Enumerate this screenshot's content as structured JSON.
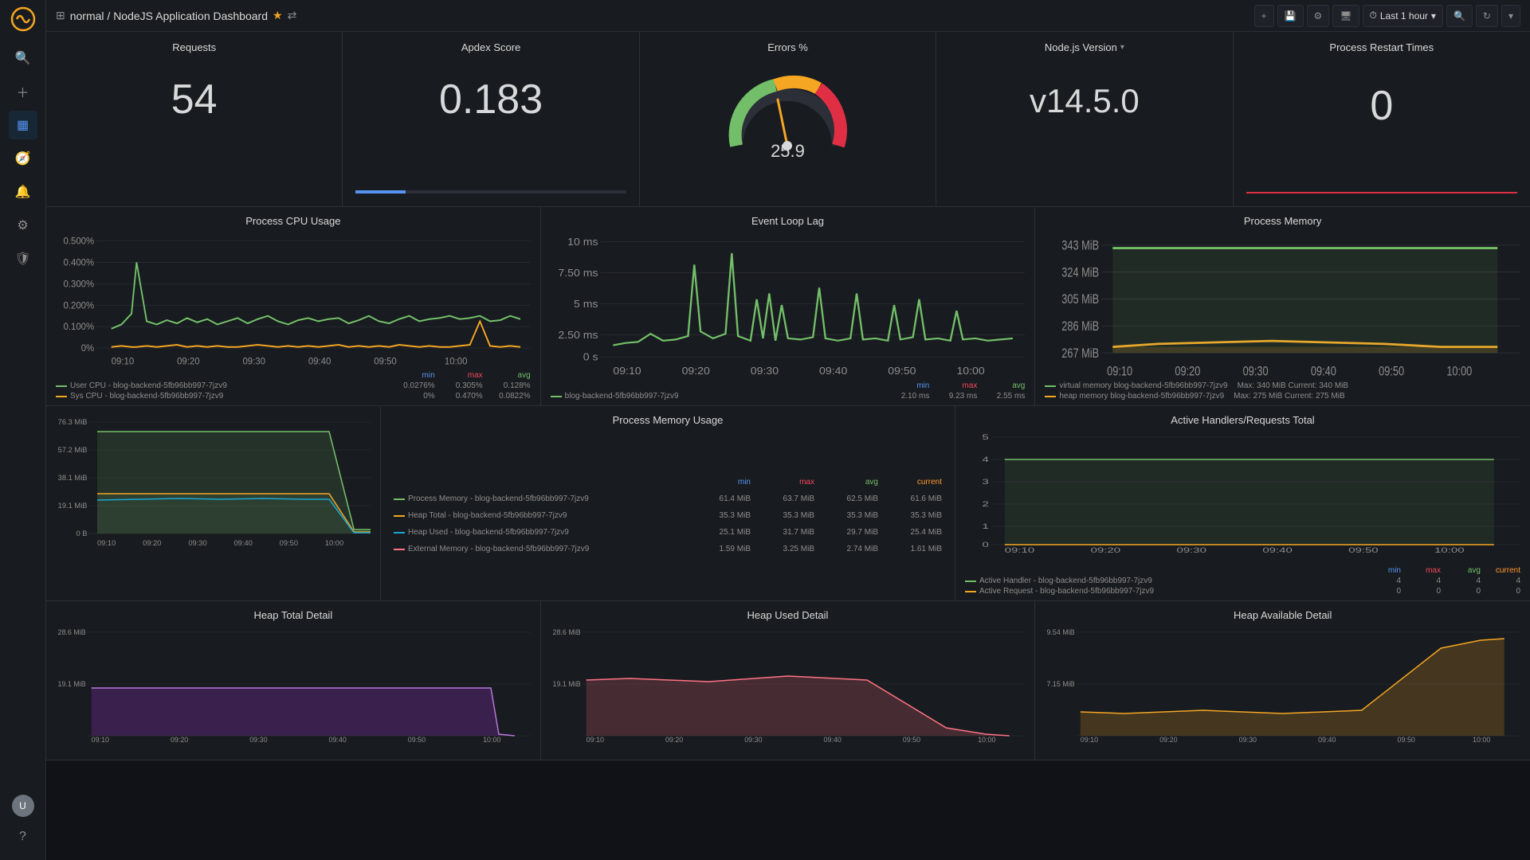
{
  "app": {
    "title": "normal / NodeJS Application Dashboard",
    "breadcrumb": "normal / NodeJS Application Dashboard"
  },
  "topbar": {
    "grid_icon": "⊞",
    "title": "normal / NodeJS Application Dashboard",
    "star_label": "★",
    "share_label": "⇄",
    "add_panel": "+",
    "save_label": "💾",
    "settings_label": "⚙",
    "monitor_label": "🖥",
    "time_range": "Last 1 hour",
    "zoom_out": "🔍",
    "refresh": "↻",
    "dropdown": "▾"
  },
  "stats": {
    "requests": {
      "title": "Requests",
      "value": "54"
    },
    "apdex": {
      "title": "Apdex Score",
      "value": "0.183"
    },
    "errors": {
      "title": "Errors %",
      "value": "25.9"
    },
    "nodejs": {
      "title": "Node.js Version",
      "value": "v14.5.0"
    },
    "restarts": {
      "title": "Process Restart Times",
      "value": "0"
    }
  },
  "cpu_chart": {
    "title": "Process CPU Usage",
    "y_labels": [
      "0.500%",
      "0.400%",
      "0.300%",
      "0.200%",
      "0.100%",
      "0%"
    ],
    "x_labels": [
      "09:10",
      "09:20",
      "09:30",
      "09:40",
      "09:50",
      "10:00"
    ],
    "legend_headers": [
      "",
      "min",
      "max",
      "avg"
    ],
    "legend": [
      {
        "color": "#73bf69",
        "label": "User CPU - blog-backend-5fb96bb997-7jzv9",
        "min": "0.0276%",
        "max": "0.305%",
        "avg": "0.128%"
      },
      {
        "color": "#f5a623",
        "label": "Sys CPU - blog-backend-5fb96bb997-7jzv9",
        "min": "0%",
        "max": "0.470%",
        "avg": "0.0822%"
      }
    ]
  },
  "event_chart": {
    "title": "Event Loop Lag",
    "y_labels": [
      "10 ms",
      "7.50 ms",
      "5 ms",
      "2.50 ms",
      "0 s"
    ],
    "x_labels": [
      "09:10",
      "09:20",
      "09:30",
      "09:40",
      "09:50",
      "10:00"
    ],
    "legend_headers": [
      "",
      "min",
      "max",
      "avg"
    ],
    "legend": [
      {
        "color": "#73bf69",
        "label": "blog-backend-5fb96bb997-7jzv9",
        "min": "2.10 ms",
        "max": "9.23 ms",
        "avg": "2.55 ms"
      }
    ]
  },
  "memory_chart": {
    "title": "Process Memory",
    "y_labels": [
      "343 MiB",
      "324 MiB",
      "305 MiB",
      "286 MiB",
      "267 MiB"
    ],
    "x_labels": [
      "09:10",
      "09:20",
      "09:30",
      "09:40",
      "09:50",
      "10:00"
    ],
    "legend": [
      {
        "color": "#73bf69",
        "label": "virtual memory blog-backend-5fb96bb997-7jzv9",
        "extra": "Max: 340 MiB  Current: 340 MiB"
      },
      {
        "color": "#f5a623",
        "label": "heap memory blog-backend-5fb96bb997-7jzv9",
        "extra": "Max: 275 MiB  Current: 275 MiB"
      }
    ]
  },
  "memory_usage": {
    "title": "Process Memory Usage",
    "y_labels": [
      "76.3 MiB",
      "57.2 MiB",
      "38.1 MiB",
      "19.1 MiB",
      "0 B"
    ],
    "x_labels": [
      "09:10",
      "09:20",
      "09:30",
      "09:40",
      "09:50",
      "10:00"
    ],
    "headers": [
      "",
      "min",
      "max",
      "avg",
      "current"
    ],
    "rows": [
      {
        "color": "#73bf69",
        "label": "Process Memory - blog-backend-5fb96bb997-7jzv9",
        "min": "61.4 MiB",
        "max": "63.7 MiB",
        "avg": "62.5 MiB",
        "current": "61.6 MiB"
      },
      {
        "color": "#f5a623",
        "label": "Heap Total - blog-backend-5fb96bb997-7jzv9",
        "min": "35.3 MiB",
        "max": "35.3 MiB",
        "avg": "35.3 MiB",
        "current": "35.3 MiB"
      },
      {
        "color": "#19a8d6",
        "label": "Heap Used - blog-backend-5fb96bb997-7jzv9",
        "min": "25.1 MiB",
        "max": "31.7 MiB",
        "avg": "29.7 MiB",
        "current": "25.4 MiB"
      },
      {
        "color": "#ff7383",
        "label": "External Memory - blog-backend-5fb96bb997-7jzv9",
        "min": "1.59 MiB",
        "max": "3.25 MiB",
        "avg": "2.74 MiB",
        "current": "1.61 MiB"
      }
    ]
  },
  "handlers": {
    "title": "Active Handlers/Requests Total",
    "y_labels": [
      "5",
      "4",
      "3",
      "2",
      "1",
      "0"
    ],
    "x_labels": [
      "09:10",
      "09:20",
      "09:30",
      "09:40",
      "09:50",
      "10:00"
    ],
    "legend_headers": [
      "",
      "min",
      "max",
      "avg",
      "current"
    ],
    "rows": [
      {
        "color": "#73bf69",
        "label": "Active Handler - blog-backend-5fb96bb997-7jzv9",
        "min": "4",
        "max": "4",
        "avg": "4",
        "current": "4"
      },
      {
        "color": "#f5a623",
        "label": "Active Request - blog-backend-5fb96bb997-7jzv9",
        "min": "0",
        "max": "0",
        "avg": "0",
        "current": "0"
      }
    ]
  },
  "heap_total": {
    "title": "Heap Total Detail",
    "y_labels": [
      "28.6 MiB",
      "19.1 MiB"
    ],
    "x_labels": [
      "09:10",
      "09:20",
      "09:30",
      "09:40",
      "09:50",
      "10:00"
    ]
  },
  "heap_used": {
    "title": "Heap Used Detail",
    "y_labels": [
      "28.6 MiB",
      "19.1 MiB"
    ],
    "x_labels": [
      "09:10",
      "09:20",
      "09:30",
      "09:40",
      "09:50",
      "10:00"
    ]
  },
  "heap_available": {
    "title": "Heap Available Detail",
    "y_labels": [
      "9.54 MiB",
      "7.15 MiB"
    ],
    "x_labels": [
      "09:10",
      "09:20",
      "09:30",
      "09:40",
      "09:50",
      "10:00"
    ]
  },
  "sidebar": {
    "icons": [
      "search",
      "plus",
      "grid",
      "compass",
      "bell",
      "settings",
      "shield"
    ]
  }
}
